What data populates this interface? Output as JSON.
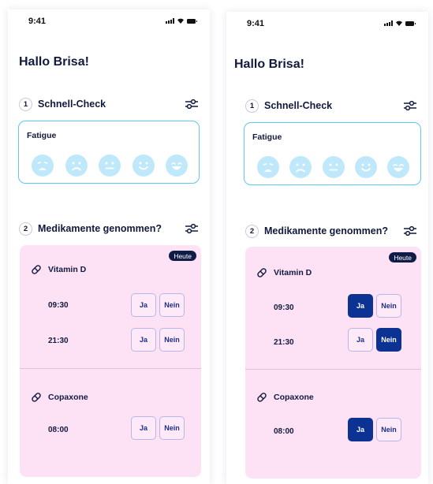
{
  "screens": [
    {
      "status_time": "9:41",
      "greeting": "Hallo Brisa!",
      "section1": {
        "number": "1",
        "title": "Schnell-Check"
      },
      "fatigue_label": "Fatigue",
      "faces": [
        "very-sad-face-icon",
        "sad-face-icon",
        "neutral-face-icon",
        "smile-face-icon",
        "grin-face-icon"
      ],
      "section2": {
        "number": "2",
        "title": "Medikamente genommen?"
      },
      "today_badge": "Heute",
      "meds": [
        {
          "name": "Vitamin D",
          "doses": [
            {
              "time": "09:30",
              "selected": "none"
            },
            {
              "time": "21:30",
              "selected": "none"
            }
          ]
        },
        {
          "name": "Copaxone",
          "doses": [
            {
              "time": "08:00",
              "selected": "none"
            }
          ]
        }
      ],
      "yes_label": "Ja",
      "no_label": "Nein"
    },
    {
      "status_time": "9:41",
      "greeting": "Hallo Brisa!",
      "section1": {
        "number": "1",
        "title": "Schnell-Check"
      },
      "fatigue_label": "Fatigue",
      "faces": [
        "very-sad-face-icon",
        "sad-face-icon",
        "neutral-face-icon",
        "smile-face-icon",
        "grin-face-icon"
      ],
      "section2": {
        "number": "2",
        "title": "Medikamente genommen?"
      },
      "today_badge": "Heute",
      "meds": [
        {
          "name": "Vitamin D",
          "doses": [
            {
              "time": "09:30",
              "selected": "ja"
            },
            {
              "time": "21:30",
              "selected": "nein"
            }
          ]
        },
        {
          "name": "Copaxone",
          "doses": [
            {
              "time": "08:00",
              "selected": "ja"
            }
          ]
        }
      ],
      "yes_label": "Ja",
      "no_label": "Nein"
    }
  ],
  "colors": {
    "accent_blue": "#0c3394",
    "card_pink": "#fde2f6",
    "face_blue": "#bfe9fb",
    "fatigue_border": "#5ec8f0",
    "badge_navy": "#0f1c48"
  }
}
